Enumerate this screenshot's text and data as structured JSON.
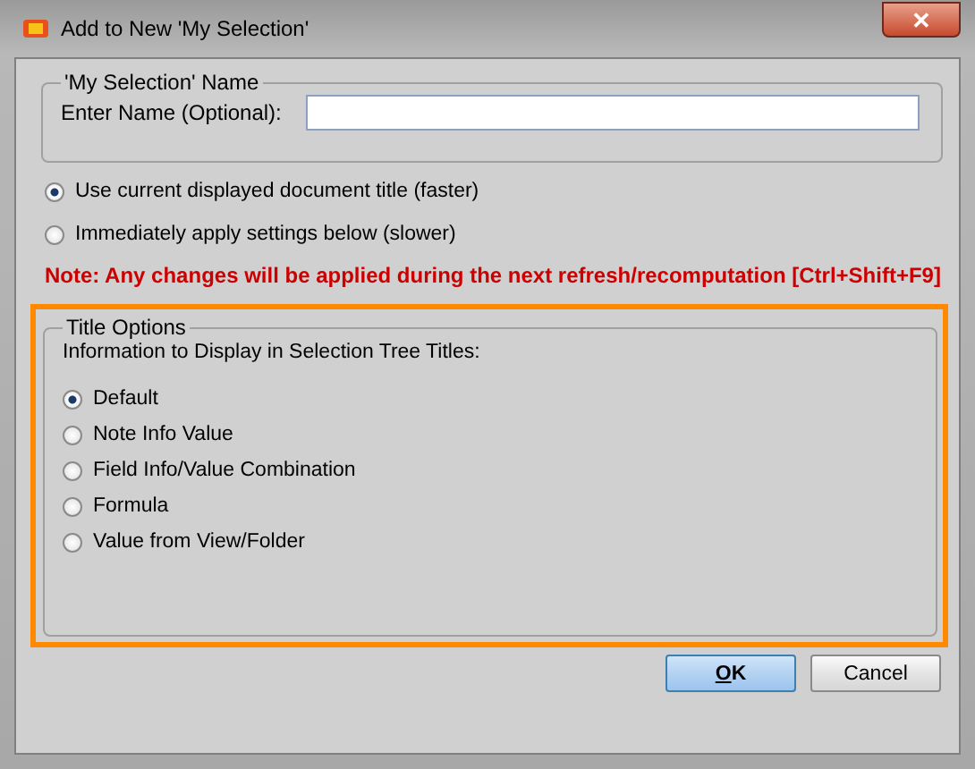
{
  "window": {
    "title": "Add to New 'My Selection'",
    "close": "✕"
  },
  "name_group": {
    "legend": "'My Selection' Name",
    "label": "Enter Name (Optional):"
  },
  "modes": [
    {
      "label": "Use current displayed document title (faster)",
      "selected": true
    },
    {
      "label": "Immediately apply settings below (slower)",
      "selected": false
    }
  ],
  "note": "Note: Any changes will be applied during the next refresh/recomputation [Ctrl+Shift+F9]",
  "title_options": {
    "highlighted": true,
    "legend": "Title Options",
    "caption": "Information to Display in Selection Tree Titles:",
    "options": [
      {
        "label": "Default",
        "selected": true
      },
      {
        "label": "Note Info Value",
        "selected": false
      },
      {
        "label": "Field Info/Value Combination",
        "selected": false
      },
      {
        "label": "Formula",
        "selected": false
      },
      {
        "label": "Value from View/Folder",
        "selected": false
      }
    ]
  },
  "buttons": [
    {
      "label": "OK",
      "default": true
    },
    {
      "label": "Cancel",
      "default": false
    }
  ]
}
